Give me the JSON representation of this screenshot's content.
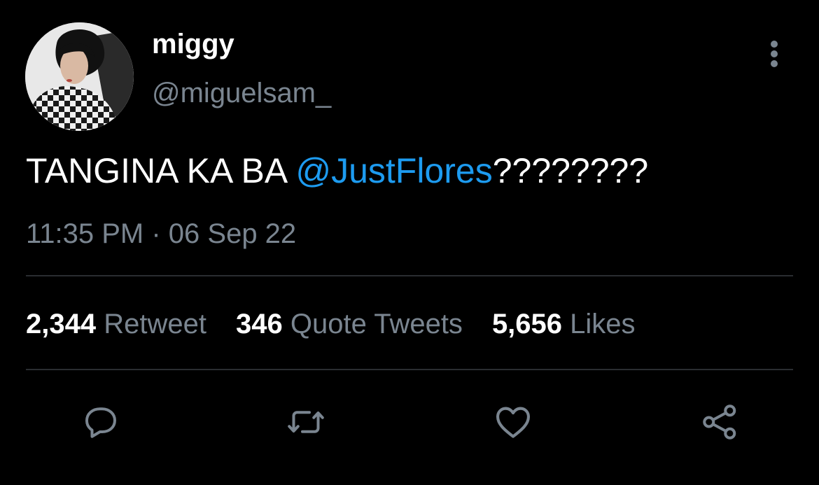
{
  "author": {
    "display_name": "miggy",
    "handle": "@miguelsam_"
  },
  "tweet": {
    "text_prefix": "TANGINA KA BA ",
    "mention": "@JustFlores",
    "text_suffix": "????????",
    "timestamp": "11:35 PM · 06 Sep 22"
  },
  "stats": {
    "retweets_count": "2,344",
    "retweets_label": "Retweet",
    "quotes_count": "346",
    "quotes_label": "Quote Tweets",
    "likes_count": "5,656",
    "likes_label": "Likes"
  },
  "actions": {
    "reply_icon": "reply-icon",
    "retweet_icon": "retweet-icon",
    "like_icon": "heart-icon",
    "share_icon": "share-icon",
    "more_icon": "more-vertical-icon"
  },
  "colors": {
    "background": "#000000",
    "text_primary": "#ffffff",
    "text_secondary": "#7a8590",
    "link": "#1d9bf0",
    "divider": "#2a2d31"
  }
}
